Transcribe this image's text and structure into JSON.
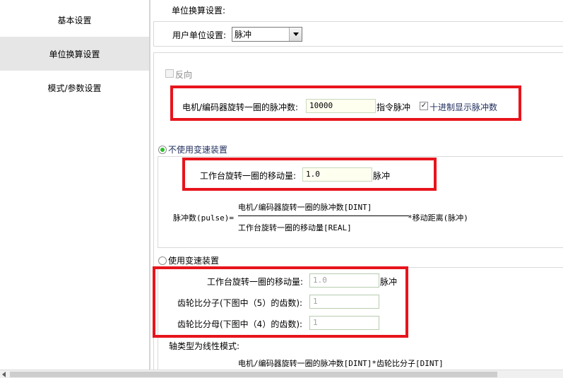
{
  "nav": {
    "items": [
      {
        "label": "基本设置"
      },
      {
        "label": "单位换算设置"
      },
      {
        "label": "模式/参数设置"
      }
    ],
    "active_index": 1
  },
  "unit": {
    "section_title": "单位换算设置:",
    "user_unit_label": "用户单位设置:",
    "user_unit_value": "脉冲"
  },
  "reverse": {
    "label": "反向",
    "checked": false,
    "enabled": false
  },
  "encoder": {
    "label": "电机/编码器旋转一圈的脉冲数:",
    "value": "10000",
    "unit": "指令脉冲",
    "decimal_checkbox_label": "十进制显示脉冲数",
    "decimal_checked": true
  },
  "no_gear": {
    "radio_label": "不使用变速装置",
    "selected": true,
    "move_label": "工作台旋转一圈的移动量:",
    "move_value": "1.0",
    "move_unit": "脉冲",
    "formula": {
      "left": "脉冲数(pulse)=",
      "numerator": "电机/编码器旋转一圈的脉冲数[DINT]",
      "denominator": "工作台旋转一圈的移动量[REAL]",
      "right": "*移动距离(脉冲)"
    }
  },
  "gear": {
    "radio_label": "使用变速装置",
    "selected": false,
    "move_label": "工作台旋转一圈的移动量:",
    "move_value": "1.0",
    "move_unit": "脉冲",
    "numerator_label": "齿轮比分子(下图中（5）的齿数):",
    "numerator_value": "1",
    "denominator_label": "齿轮比分母(下图中（4）的齿数):",
    "denominator_value": "1",
    "axis_mode_label": "轴类型为线性模式:",
    "formula_numerator": "电机/编码器旋转一圈的脉冲数[DINT]*齿轮比分子[DINT]"
  },
  "colors": {
    "highlight_border": "#e8141c",
    "active_nav_bg": "#e6e6e6",
    "radio_dot": "#2cbf2c",
    "input_bg": "#fffff0"
  }
}
